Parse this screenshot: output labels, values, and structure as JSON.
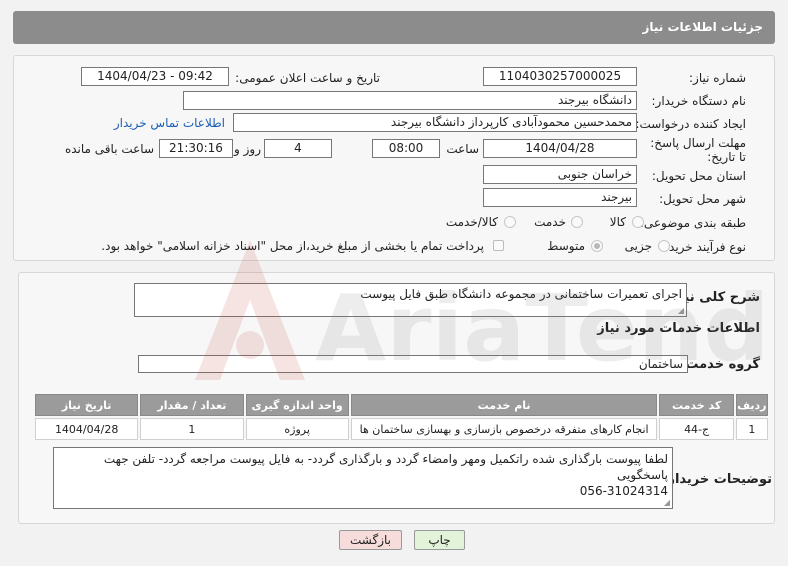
{
  "header": {
    "title": "جزئیات اطلاعات نیاز"
  },
  "fields": {
    "need_number_label": "شماره نیاز:",
    "need_number": "1104030257000025",
    "announce_label": "تاریخ و ساعت اعلان عمومی:",
    "announce_value": "1404/04/23 - 09:42",
    "buyer_org_label": "نام دستگاه خریدار:",
    "buyer_org": "دانشگاه بیرجند",
    "creator_label": "ایجاد کننده درخواست:",
    "creator": "محمدحسین محمودآبادی کارپرداز دانشگاه بیرجند",
    "contact_link": "اطلاعات تماس خریدار",
    "deadline_label": "مهلت ارسال پاسخ: تا تاریخ:",
    "deadline_date": "1404/04/28",
    "time_label": "ساعت",
    "deadline_time": "08:00",
    "days": "4",
    "days_label": "روز و",
    "remaining_time": "21:30:16",
    "remaining_label": "ساعت باقی مانده",
    "province_label": "استان محل تحویل:",
    "province": "خراسان جنوبی",
    "city_label": "شهر محل تحویل:",
    "city": "بیرجند",
    "category_label": "طبقه بندی موضوعی:",
    "category_options": [
      "کالا",
      "خدمت",
      "کالا/خدمت"
    ],
    "process_label": "نوع فرآیند خرید :",
    "process_options": [
      "جزیی",
      "متوسط"
    ],
    "payment_note": "پرداخت تمام یا بخشی از مبلغ خرید،از محل \"اسناد خزانه اسلامی\" خواهد بود."
  },
  "description": {
    "label": "شرح کلی نیاز:",
    "value": "اجرای تعمیرات ساختمانی در مجموعه دانشگاه طبق فایل پیوست"
  },
  "services": {
    "section_title": "اطلاعات خدمات مورد نیاز",
    "group_label": "گروه خدمت:",
    "group_value": "ساختمان",
    "columns": [
      "ردیف",
      "کد خدمت",
      "نام خدمت",
      "واحد اندازه گیری",
      "تعداد / مقدار",
      "تاریخ نیاز"
    ],
    "rows": [
      [
        "1",
        "ج-44",
        "انجام کارهای متفرقه درخصوص بازسازی و بهسازی ساختمان ها",
        "پروژه",
        "1",
        "1404/04/28"
      ]
    ]
  },
  "buyer_notes": {
    "label": "توضیحات خریدار:",
    "value_line1": "لطفا پیوست بارگذاری شده راتکمیل ومهر وامضاء گردد و بارگذاری گردد- به فایل پیوست مراجعه گردد- تلفن جهت پاسخگویی",
    "value_line2": "056-31024314"
  },
  "buttons": {
    "print": "چاپ",
    "back": "بازگشت"
  },
  "watermark": {
    "text": "AriaTender.net"
  },
  "colors": {
    "header": "#8c8c8c",
    "link": "#1a5fb4",
    "print_btn": "#e3f3d9",
    "back_btn": "#f7dcdc"
  }
}
